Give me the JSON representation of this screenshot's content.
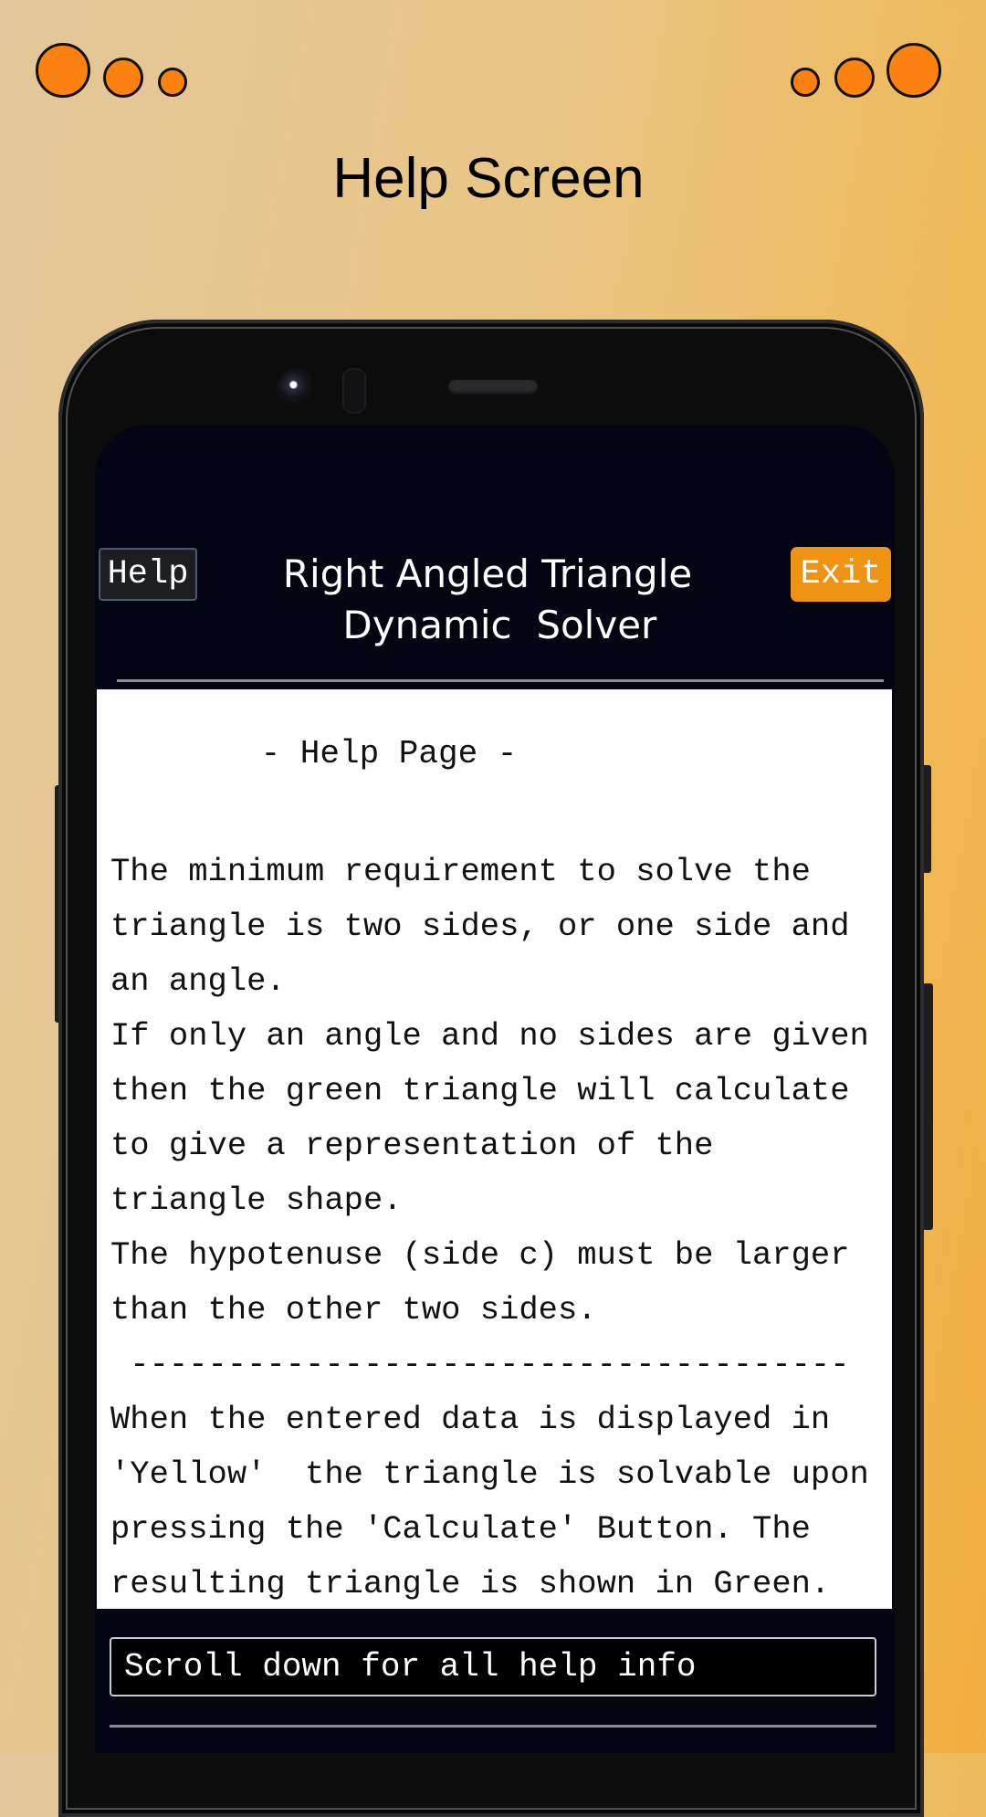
{
  "page": {
    "title": "Help Screen"
  },
  "decorations": {
    "dot_color": "#fb8210",
    "left_dots": [
      "big-dot-icon",
      "medium-dot-icon",
      "small-dot-icon"
    ],
    "right_dots": [
      "small-dot-icon",
      "medium-dot-icon",
      "big-dot-icon"
    ]
  },
  "app": {
    "help_button": "Help",
    "exit_button": "Exit",
    "exit_color": "#ee9314",
    "title": "Right Angled Triangle\n  Dynamic  Solver",
    "help_heading": "- Help Page -",
    "help_lines": [
      "The minimum requirement to solve the",
      "triangle is two sides, or one side and",
      "an angle.",
      "If only an angle and no sides are given",
      "then the green triangle will calculate",
      "to give a representation of the",
      "triangle shape.",
      "The hypotenuse (side c) must be larger",
      "than the other two sides.",
      " -------------------------------------",
      "When the entered data is displayed in",
      "'Yellow'  the triangle is solvable upon",
      "pressing the 'Calculate' Button. The",
      "resulting triangle is shown in Green."
    ],
    "scroll_hint": "Scroll down for all help info"
  }
}
